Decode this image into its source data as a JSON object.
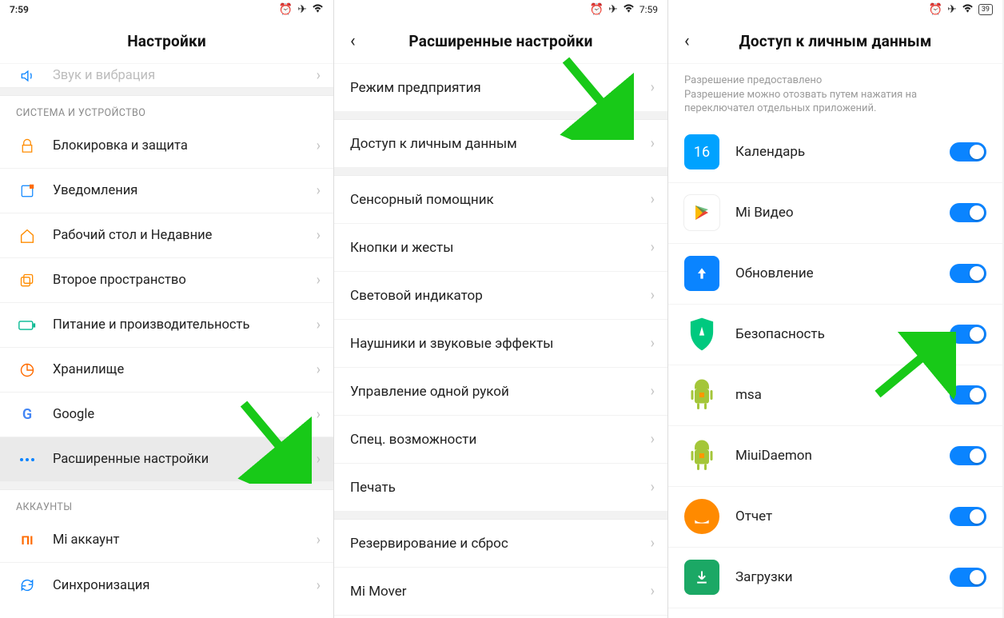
{
  "status": {
    "time": "7:59",
    "battery": "39"
  },
  "panel1": {
    "title": "Настройки",
    "cutoff": "Звук и вибрация",
    "section_system": "СИСТЕМА И УСТРОЙСТВО",
    "items": [
      {
        "label": "Блокировка и защита"
      },
      {
        "label": "Уведомления"
      },
      {
        "label": "Рабочий стол и Недавние"
      },
      {
        "label": "Второе пространство"
      },
      {
        "label": "Питание и производительность"
      },
      {
        "label": "Хранилище"
      },
      {
        "label": "Google"
      },
      {
        "label": "Расширенные настройки"
      }
    ],
    "section_accounts": "АККАУНТЫ",
    "mi_account": "Mi аккаунт",
    "sync": "Синхронизация"
  },
  "panel2": {
    "title": "Расширенные настройки",
    "items": [
      {
        "label": "Режим предприятия"
      },
      {
        "label": "Доступ к личным данным"
      },
      {
        "label": "Сенсорный помощник"
      },
      {
        "label": "Кнопки и жесты"
      },
      {
        "label": "Световой индикатор"
      },
      {
        "label": "Наушники и звуковые эффекты"
      },
      {
        "label": "Управление одной рукой"
      },
      {
        "label": "Спец. возможности"
      },
      {
        "label": "Печать"
      },
      {
        "label": "Резервирование и сброс"
      },
      {
        "label": "Mi Mover"
      }
    ]
  },
  "panel3": {
    "title": "Доступ к личным данным",
    "desc_title": "Разрешение предоставлено",
    "desc_text": "Разрешение можно отозвать путем нажатия на переключател отдельных приложений.",
    "apps": [
      {
        "label": "Календарь"
      },
      {
        "label": "Mi Видео"
      },
      {
        "label": "Обновление"
      },
      {
        "label": "Безопасность"
      },
      {
        "label": "msa"
      },
      {
        "label": "MiuiDaemon"
      },
      {
        "label": "Отчет"
      },
      {
        "label": "Загрузки"
      }
    ]
  }
}
